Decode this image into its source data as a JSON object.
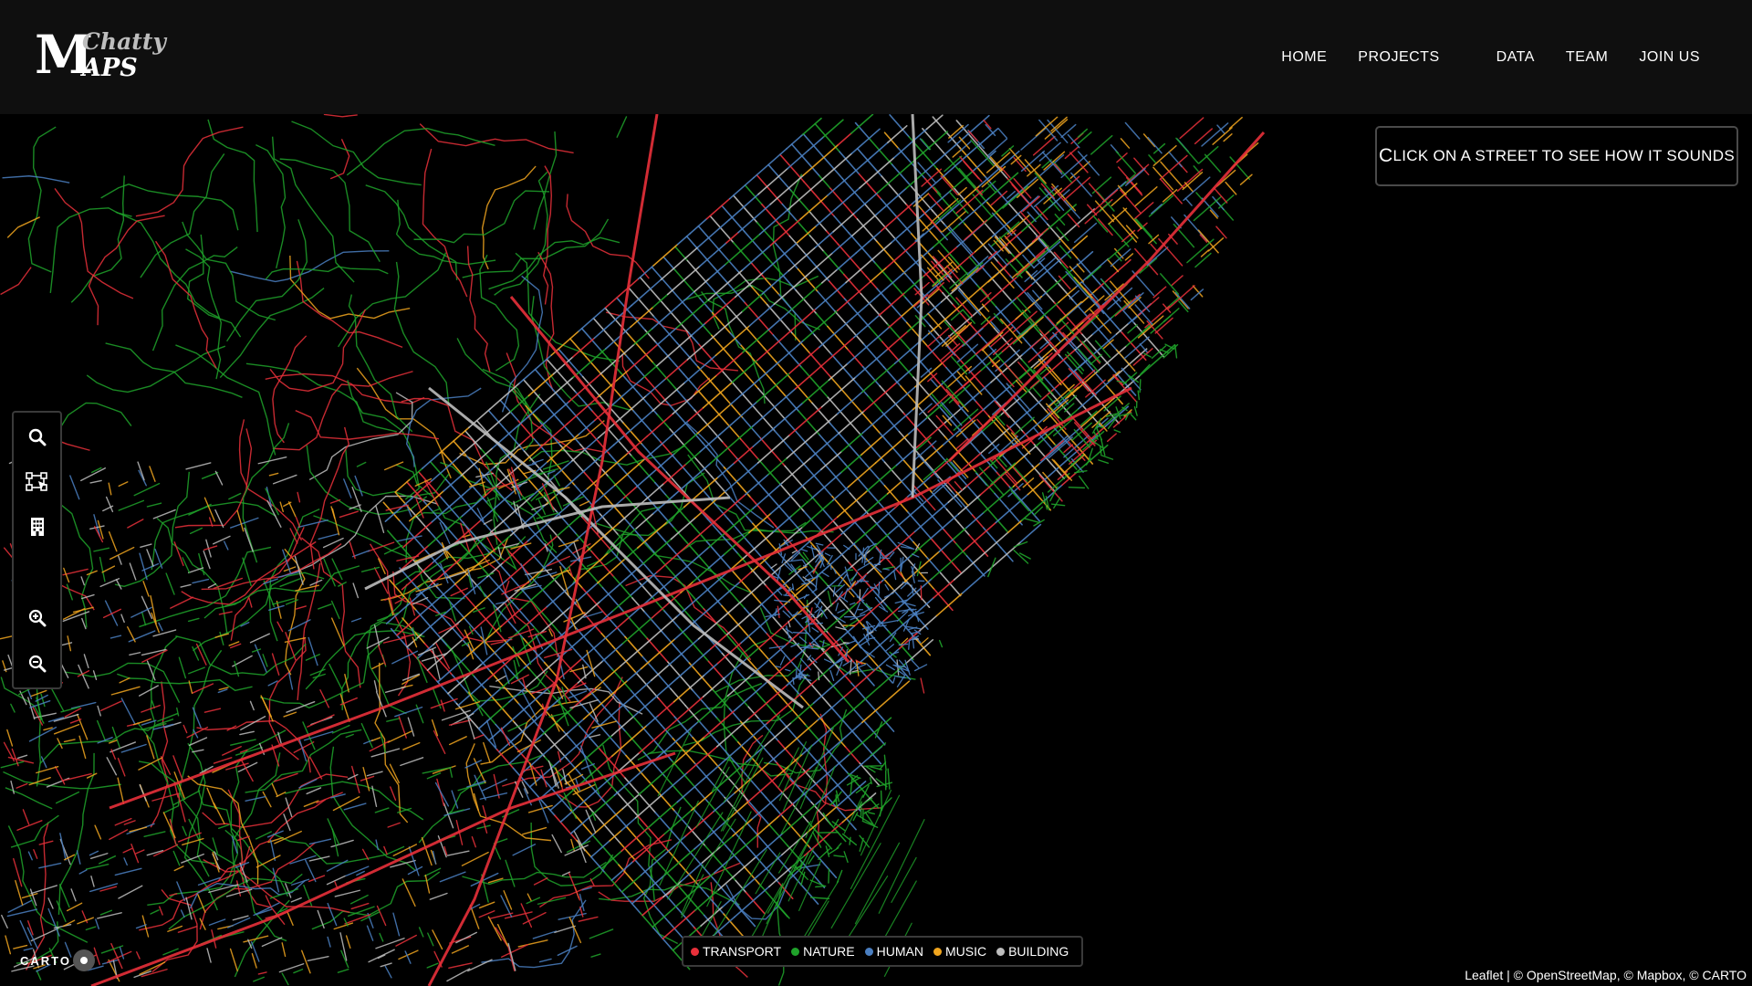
{
  "logo": {
    "m": "M",
    "top": "Chatty",
    "bottom": "APS"
  },
  "nav": {
    "items": [
      {
        "label": "HOME"
      },
      {
        "label": "PROJECTS"
      },
      {
        "label": "DATA"
      },
      {
        "label": "TEAM"
      },
      {
        "label": "JOIN US"
      }
    ]
  },
  "info_box": {
    "first_letter": "C",
    "rest": "LICK ON A STREET TO SEE HOW IT SOUNDS"
  },
  "toolbar": {
    "buttons": [
      {
        "name": "search-icon"
      },
      {
        "name": "select-area-icon"
      },
      {
        "name": "building-icon"
      },
      {
        "name": "zoom-in-icon"
      },
      {
        "name": "zoom-out-icon"
      }
    ]
  },
  "legend": {
    "items": [
      {
        "label": "TRANSPORT",
        "color": "#e8303a"
      },
      {
        "label": "NATURE",
        "color": "#1fa22a"
      },
      {
        "label": "HUMAN",
        "color": "#4a7fc1"
      },
      {
        "label": "MUSIC",
        "color": "#f0a51e"
      },
      {
        "label": "BUILDING",
        "color": "#bdbdbd"
      }
    ]
  },
  "map": {
    "basemap_color": "#000000",
    "category_colors": {
      "transport": "#e8303a",
      "nature": "#1fa22a",
      "human": "#4a7fc1",
      "music": "#f0a51e",
      "building": "#bdbdbd"
    }
  },
  "carto": {
    "label": "CARTO"
  },
  "attribution": {
    "leaflet": "Leaflet",
    "rest": "| © OpenStreetMap, © Mapbox, © CARTO"
  }
}
